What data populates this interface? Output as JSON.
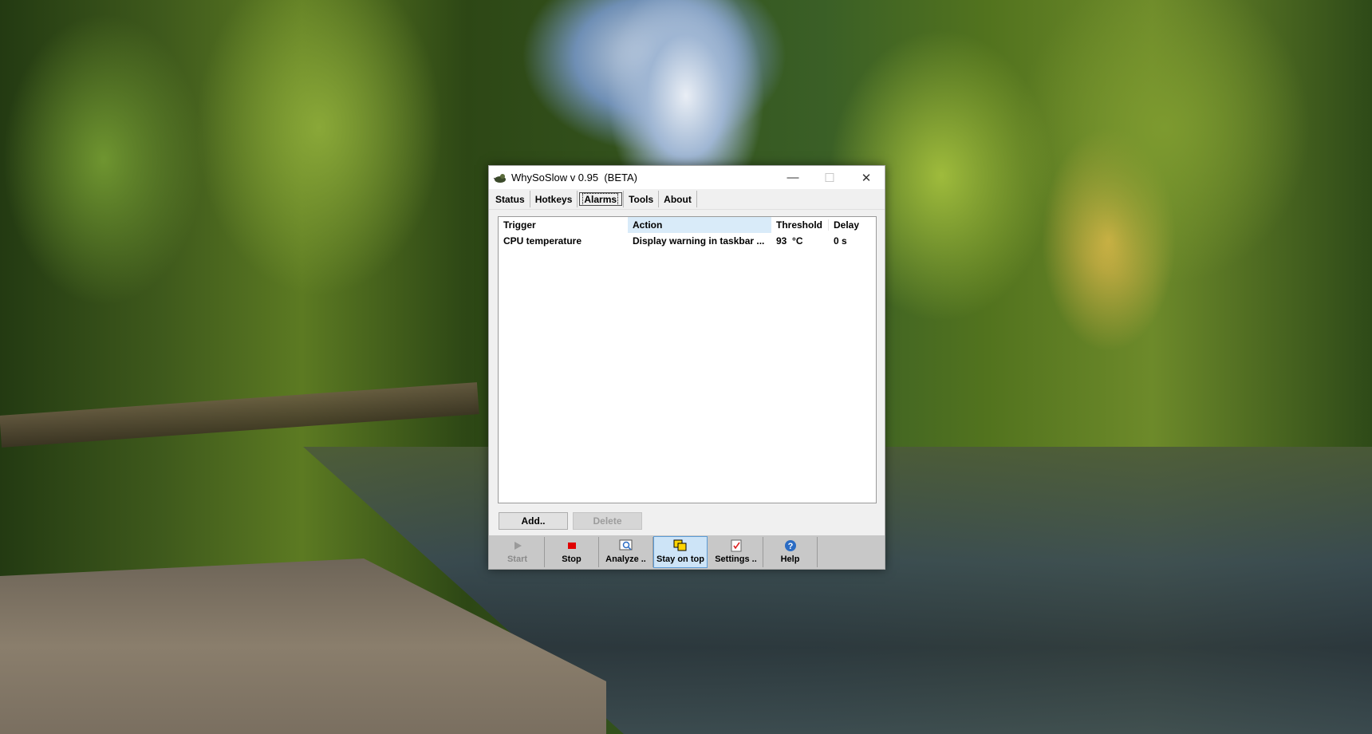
{
  "window": {
    "title": "WhySoSlow v 0.95  (BETA)",
    "controls": {
      "minimize": "—",
      "maximize": "☐",
      "close": "✕"
    }
  },
  "menu": [
    {
      "label": "Status",
      "underline": "S"
    },
    {
      "label": "Hotkeys",
      "underline": "H"
    },
    {
      "label": "Alarms",
      "underline": "A",
      "active": true
    },
    {
      "label": "Tools",
      "underline": "T"
    },
    {
      "label": "About",
      "underline": "A"
    }
  ],
  "alarms_table": {
    "columns": [
      "Trigger",
      "Action",
      "Threshold",
      "Delay"
    ],
    "rows": [
      {
        "trigger": "CPU temperature",
        "action": "Display warning in taskbar ...",
        "threshold": "93  °C",
        "delay": "0 s"
      }
    ]
  },
  "buttons": {
    "add": "Add..",
    "delete": "Delete"
  },
  "toolbar": [
    {
      "label": "Start",
      "icon": "play-icon",
      "enabled": false
    },
    {
      "label": "Stop",
      "icon": "stop-icon",
      "enabled": true
    },
    {
      "label": "Analyze ..",
      "icon": "analyze-icon",
      "enabled": true
    },
    {
      "label": "Stay on top",
      "icon": "stay-on-top-icon",
      "enabled": true,
      "pressed": true
    },
    {
      "label": "Settings ..",
      "icon": "settings-icon",
      "enabled": true
    },
    {
      "label": "Help",
      "icon": "help-icon",
      "enabled": true
    }
  ],
  "colors": {
    "accent": "#0078d7",
    "stop": "#e00000",
    "header_highlight": "#d9ebf9"
  }
}
